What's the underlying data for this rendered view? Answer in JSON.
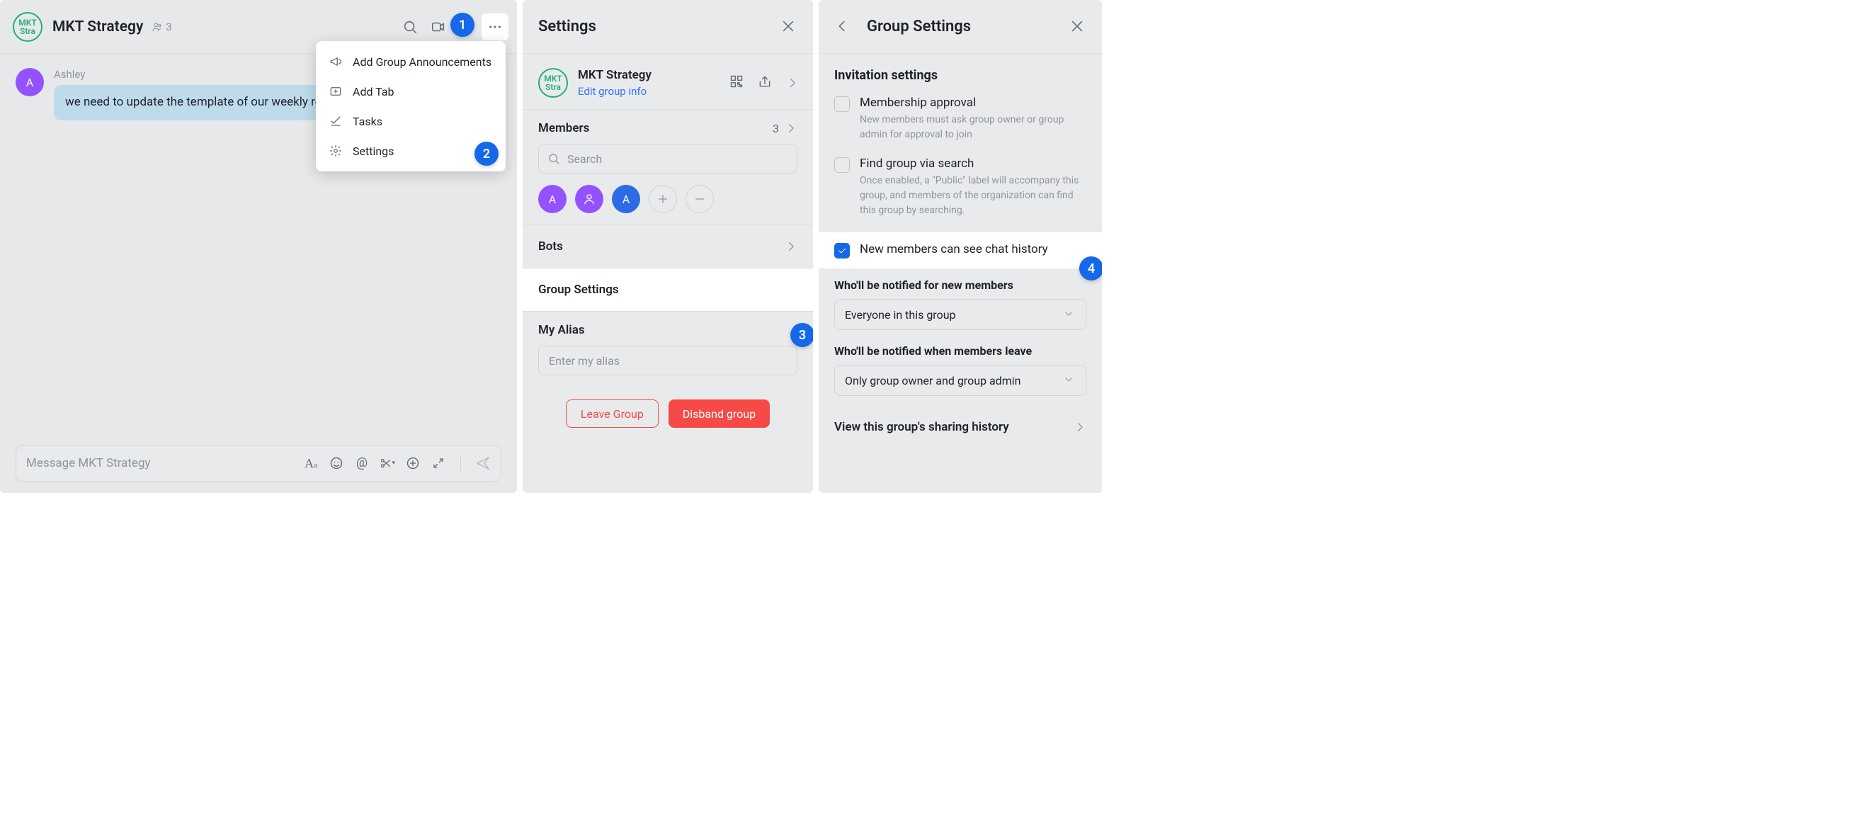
{
  "chat": {
    "group_avatar_line1": "MKT",
    "group_avatar_line2": "Stra",
    "group_name": "MKT Strategy",
    "member_count": "3",
    "sender_name": "Ashley",
    "sender_initial": "A",
    "message_text": "we need to update the template of our weekly report by friday",
    "composer_placeholder": "Message MKT Strategy"
  },
  "dropdown": {
    "item_announcements": "Add Group Announcements",
    "item_add_tab": "Add Tab",
    "item_tasks": "Tasks",
    "item_settings": "Settings"
  },
  "badges": {
    "b1": "1",
    "b2": "2",
    "b3": "3",
    "b4": "4"
  },
  "settings": {
    "title": "Settings",
    "group_name": "MKT Strategy",
    "edit_link": "Edit group info",
    "members_label": "Members",
    "members_count": "3",
    "search_placeholder": "Search",
    "bots_label": "Bots",
    "group_settings_label": "Group Settings",
    "my_alias_label": "My Alias",
    "alias_placeholder": "Enter my alias",
    "leave_btn": "Leave Group",
    "disband_btn": "Disband group",
    "avatars": {
      "a": "A",
      "a2": "A"
    }
  },
  "group_settings": {
    "title": "Group Settings",
    "invitation_h": "Invitation settings",
    "opt1_label": "Membership approval",
    "opt1_desc": "New members must ask group owner or group admin for approval to join",
    "opt2_label": "Find group via search",
    "opt2_desc": "Once enabled, a \"Public\" label will accompany this group, and members of the organization can find this group by searching.",
    "opt3_label": "New members can see chat history",
    "notify_new_h": "Who'll be notified for new members",
    "notify_new_val": "Everyone in this group",
    "notify_leave_h": "Who'll be notified when members leave",
    "notify_leave_val": "Only group owner and group admin",
    "share_history": "View this group's sharing history"
  }
}
